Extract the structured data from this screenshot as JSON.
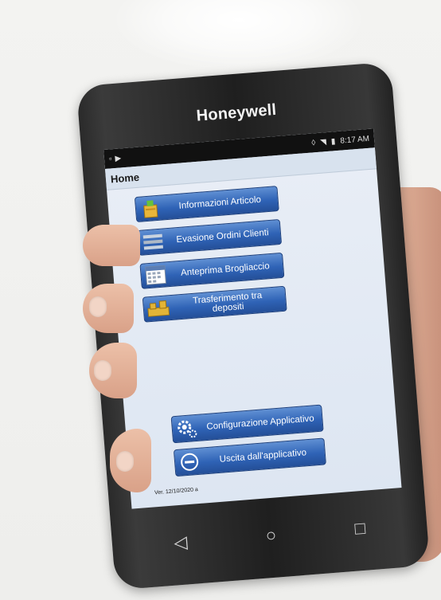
{
  "device": {
    "brand": "Honeywell"
  },
  "status_bar": {
    "time": "8:17 AM"
  },
  "app": {
    "title": "Home",
    "menu": [
      {
        "label": "Informazioni Articolo",
        "icon": "article-box-icon"
      },
      {
        "label": "Evasione Ordini Clienti",
        "icon": "list-lines-icon"
      },
      {
        "label": "Anteprima Brogliaccio",
        "icon": "calendar-grid-icon"
      },
      {
        "label": "Trasferimento tra depositi",
        "icon": "transfer-boxes-icon"
      }
    ],
    "bottom_menu": [
      {
        "label": "Configurazione Applicativo",
        "icon": "gears-icon"
      },
      {
        "label": "Uscita dall'applicativo",
        "icon": "exit-minus-icon"
      }
    ],
    "version": "Ver. 12/10/2020 a"
  },
  "nav": {
    "back": "◁",
    "home": "○",
    "recents": "□"
  },
  "colors": {
    "button_top": "#5f8fd3",
    "button_bottom": "#244f98",
    "screen_bg": "#e3eaf4"
  }
}
